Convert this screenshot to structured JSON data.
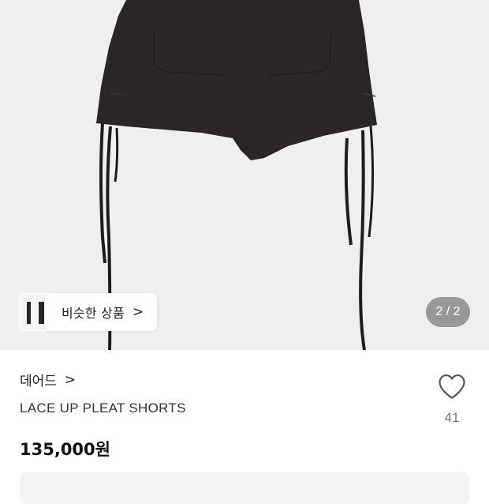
{
  "product_image": {
    "description": "black lace-up pleat shorts"
  },
  "similar_products": {
    "label": "비슷한 상품",
    "chevron": ">"
  },
  "image_counter": {
    "text": "2 / 2",
    "current": 2,
    "total": 2
  },
  "brand": {
    "name": "데어드",
    "chevron": ">"
  },
  "product": {
    "name": "LACE UP PLEAT SHORTS",
    "price": "135,000원"
  },
  "like": {
    "icon": "heart-outline-icon",
    "count": "41"
  },
  "colors": {
    "image_bg": "#efeff0",
    "garment": "#2a2628",
    "counter_bg": "#98989a"
  }
}
